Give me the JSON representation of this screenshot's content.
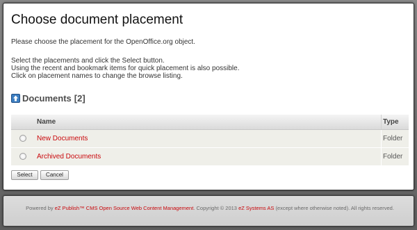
{
  "page": {
    "title": "Choose document placement",
    "intro": "Please choose the placement for the OpenOffice.org object.",
    "instructions": [
      "Select the placements and click the Select button.",
      "Using the recent and bookmark items for quick placement is also possible.",
      "Click on placement names to change the browse listing."
    ]
  },
  "browse": {
    "icon": "up-arrow-icon",
    "title": "Documents",
    "count": "[2]",
    "columns": {
      "name": "Name",
      "type": "Type"
    },
    "rows": [
      {
        "name": "New Documents",
        "type": "Folder"
      },
      {
        "name": "Archived Documents",
        "type": "Folder"
      }
    ]
  },
  "buttons": {
    "select": "Select",
    "cancel": "Cancel"
  },
  "footer": {
    "powered_by": "Powered by",
    "product_link": "eZ Publish™ CMS Open Source Web Content Management",
    "copyright": ". Copyright © 2013",
    "company_link": "eZ Systems AS",
    "rights": "(except where otherwise noted). All rights reserved."
  },
  "colors": {
    "link": "#c9070b",
    "background": "#6f6f6f",
    "row": "#efefe9"
  }
}
